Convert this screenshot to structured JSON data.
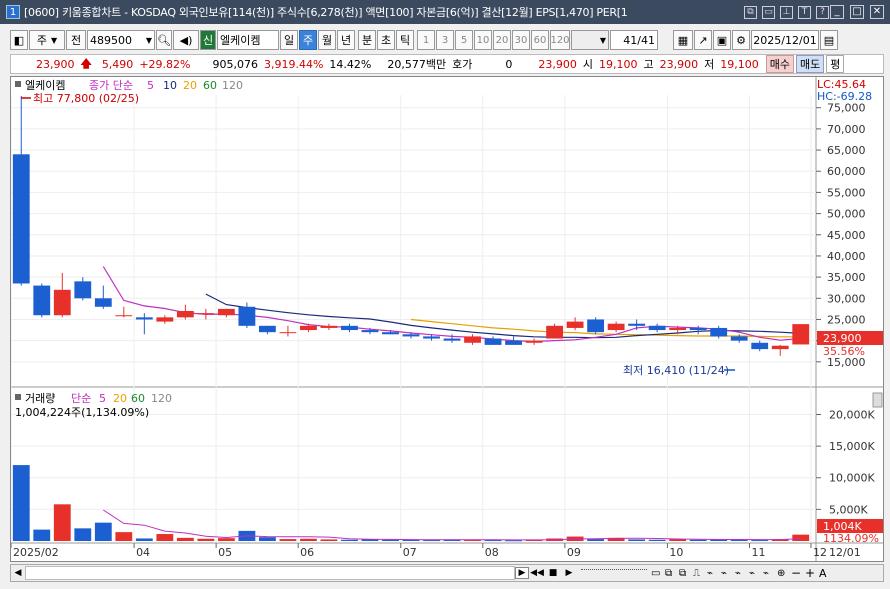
{
  "window": {
    "badge": "1",
    "title": "[0600] 키움종합차트 - KOSDAQ 외국인보유[114(천)] 주식수[6,278(천)] 액면[100] 자본금[6(억)] 결산[12월] EPS[1,470] PER[1"
  },
  "toolbar": {
    "type_label": "주",
    "kind_label": "전",
    "code": "489500",
    "shin_label": "신",
    "stock_name": "엘케이켐",
    "periods": [
      "일",
      "주",
      "월",
      "년"
    ],
    "active_period": "주",
    "minute_labels": [
      "분",
      "초",
      "틱"
    ],
    "intervals": [
      "1",
      "3",
      "5",
      "10",
      "20",
      "30",
      "60",
      "120"
    ],
    "count": "41",
    "count_total": "/41",
    "date": "2025/12/01"
  },
  "quote": {
    "price": "23,900",
    "change": "5,490",
    "change_pct": "+29.82%",
    "volume": "905,076",
    "vol_ratio": "3,919.44%",
    "turnover": "14.42%",
    "amount": "20,577백만",
    "hoga_label": "호가",
    "hoga_value": "0",
    "price2": "23,900",
    "open_label": "시",
    "open": "19,100",
    "high_label": "고",
    "high": "23,900",
    "low_label": "저",
    "low": "19,100",
    "buy_label": "매수",
    "sell_label": "매도",
    "flat_label": "평"
  },
  "price_panel": {
    "stock_label": "엘케이켐",
    "ma_label": "종가 단순",
    "ma_periods": [
      "5",
      "10",
      "20",
      "60",
      "120"
    ],
    "high_note": "최고 77,800 (02/25)",
    "low_note": "최저 16,410 (11/24)",
    "lc": "LC:45.64",
    "hc": "HC:-69.28",
    "current_tag": "23,900",
    "current_pct": "35.56%",
    "y_labels": [
      "75,000",
      "70,000",
      "65,000",
      "60,000",
      "55,000",
      "50,000",
      "45,000",
      "40,000",
      "35,000",
      "30,000",
      "25,000",
      "20,000",
      "15,000"
    ]
  },
  "volume_panel": {
    "label": "거래량",
    "ma_label": "단순",
    "ma_periods": [
      "5",
      "20",
      "60",
      "120"
    ],
    "first_note": "1,004,224주(1,134.09%)",
    "current_tag": "1,004K",
    "current_pct": "1134.09%",
    "y_labels": [
      "20,000K",
      "15,000K",
      "10,000K",
      "5,000K"
    ]
  },
  "x_axis": {
    "labels": [
      "2025/02",
      "04",
      "05",
      "06",
      "07",
      "08",
      "09",
      "10",
      "11",
      "12",
      "12/01"
    ]
  },
  "colors": {
    "up": "#e8302a",
    "down": "#1c5fd1",
    "ma5": "#c02fc0",
    "ma10": "#1a2a7a",
    "ma20": "#e8a000"
  },
  "chart_data": {
    "type": "candlestick",
    "candles": [
      {
        "o": 64000,
        "h": 77800,
        "l": 33000,
        "c": 33500
      },
      {
        "o": 33000,
        "h": 33500,
        "l": 25500,
        "c": 26000
      },
      {
        "o": 26000,
        "h": 36000,
        "l": 25500,
        "c": 32000
      },
      {
        "o": 34000,
        "h": 35000,
        "l": 29500,
        "c": 30000
      },
      {
        "o": 30000,
        "h": 33000,
        "l": 27500,
        "c": 28000
      },
      {
        "o": 26000,
        "h": 28000,
        "l": 25500,
        "c": 26000
      },
      {
        "o": 25500,
        "h": 26500,
        "l": 21500,
        "c": 25000
      },
      {
        "o": 24500,
        "h": 26000,
        "l": 24000,
        "c": 25500
      },
      {
        "o": 25500,
        "h": 28500,
        "l": 25000,
        "c": 27000
      },
      {
        "o": 26500,
        "h": 27500,
        "l": 25000,
        "c": 26500
      },
      {
        "o": 26000,
        "h": 27500,
        "l": 25500,
        "c": 27500
      },
      {
        "o": 28000,
        "h": 29000,
        "l": 23000,
        "c": 23500
      },
      {
        "o": 23500,
        "h": 23500,
        "l": 21500,
        "c": 22000
      },
      {
        "o": 21800,
        "h": 23500,
        "l": 21000,
        "c": 22000
      },
      {
        "o": 22500,
        "h": 24000,
        "l": 22000,
        "c": 23500
      },
      {
        "o": 23000,
        "h": 24000,
        "l": 22500,
        "c": 23500
      },
      {
        "o": 23500,
        "h": 24000,
        "l": 22000,
        "c": 22500
      },
      {
        "o": 22500,
        "h": 23000,
        "l": 21500,
        "c": 22000
      },
      {
        "o": 22000,
        "h": 22500,
        "l": 21500,
        "c": 21500
      },
      {
        "o": 21500,
        "h": 22000,
        "l": 20500,
        "c": 21000
      },
      {
        "o": 21000,
        "h": 21500,
        "l": 20000,
        "c": 20500
      },
      {
        "o": 20500,
        "h": 21500,
        "l": 19500,
        "c": 20000
      },
      {
        "o": 19500,
        "h": 21500,
        "l": 19000,
        "c": 21000
      },
      {
        "o": 20500,
        "h": 21000,
        "l": 19000,
        "c": 19000
      },
      {
        "o": 20000,
        "h": 21000,
        "l": 19000,
        "c": 19000
      },
      {
        "o": 19500,
        "h": 20500,
        "l": 19000,
        "c": 20000
      },
      {
        "o": 20500,
        "h": 24000,
        "l": 20500,
        "c": 23500
      },
      {
        "o": 23000,
        "h": 25500,
        "l": 22500,
        "c": 24500
      },
      {
        "o": 25000,
        "h": 25500,
        "l": 21500,
        "c": 22000
      },
      {
        "o": 22500,
        "h": 24500,
        "l": 22000,
        "c": 24000
      },
      {
        "o": 24000,
        "h": 25000,
        "l": 22500,
        "c": 23500
      },
      {
        "o": 23500,
        "h": 24000,
        "l": 22000,
        "c": 22500
      },
      {
        "o": 22500,
        "h": 23500,
        "l": 21500,
        "c": 23000
      },
      {
        "o": 23000,
        "h": 23500,
        "l": 21500,
        "c": 22500
      },
      {
        "o": 23000,
        "h": 23500,
        "l": 20500,
        "c": 21000
      },
      {
        "o": 21000,
        "h": 21500,
        "l": 19500,
        "c": 20000
      },
      {
        "o": 19500,
        "h": 20000,
        "l": 17500,
        "c": 18000
      },
      {
        "o": 18000,
        "h": 19000,
        "l": 16410,
        "c": 18800
      },
      {
        "o": 19100,
        "h": 23900,
        "l": 19100,
        "c": 23900
      }
    ],
    "volumes": [
      12000,
      1800,
      5800,
      2000,
      2900,
      1400,
      400,
      1100,
      500,
      350,
      450,
      1600,
      600,
      300,
      350,
      250,
      200,
      250,
      200,
      180,
      150,
      250,
      200,
      150,
      120,
      180,
      400,
      700,
      300,
      500,
      250,
      200,
      300,
      200,
      250,
      200,
      150,
      300,
      1004
    ],
    "ma5": [
      null,
      null,
      null,
      null,
      37500,
      29500,
      28200,
      27600,
      26600,
      26200,
      26300,
      26000,
      25500,
      24700,
      23800,
      23300,
      23200,
      22700,
      22300,
      21800,
      21400,
      21000,
      20800,
      20400,
      20000,
      19800,
      20000,
      20200,
      20800,
      21500,
      23000,
      23400,
      23200,
      23000,
      22700,
      22000,
      20800,
      20100,
      20500
    ],
    "ma10": [
      null,
      null,
      null,
      null,
      null,
      null,
      null,
      null,
      null,
      31000,
      28500,
      27800,
      27200,
      26600,
      26100,
      25700,
      25400,
      25100,
      24400,
      23600,
      23000,
      22500,
      22000,
      21600,
      21200,
      20900,
      20800,
      20800,
      20700,
      20800,
      21200,
      21500,
      21800,
      22200,
      22400,
      22300,
      22200,
      22000,
      21700
    ],
    "ma20": [
      null,
      null,
      null,
      null,
      null,
      null,
      null,
      null,
      null,
      null,
      null,
      null,
      null,
      null,
      null,
      null,
      null,
      null,
      null,
      25000,
      24500,
      24000,
      23500,
      23000,
      22700,
      22300,
      22000,
      21900,
      21600,
      21500,
      21400,
      21300,
      21200,
      21100,
      21100,
      21100,
      21000,
      20900,
      20900
    ],
    "vol_ma5": [
      null,
      null,
      null,
      null,
      null,
      null,
      null,
      null,
      null,
      null,
      null,
      null,
      null,
      null,
      null,
      null,
      null,
      null,
      null,
      null,
      null,
      null,
      null,
      null,
      null,
      null,
      null,
      null,
      null,
      null,
      null,
      null,
      null,
      null,
      null,
      null,
      null,
      null,
      null
    ],
    "ylim": [
      10000,
      78000
    ],
    "vol_ylim": [
      0,
      21500
    ]
  }
}
